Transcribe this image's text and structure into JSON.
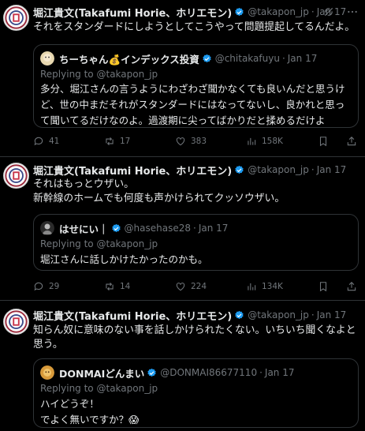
{
  "tweets": [
    {
      "author_name": "堀江貴文(Takafumi Horie、ホリエモン)",
      "handle": "@takapon_jp",
      "date": "Jan 17",
      "text": "それをスタンダードにしようとしてこうやって問題提起してるんだよ。",
      "quote": {
        "author_name": "ちーちゃん💰インデックス投資",
        "handle": "@chitakafuyu",
        "date": "Jan 17",
        "replying_label": "Replying to",
        "replying_to": "@takapon_jp",
        "text": "多分、堀江さんの言うようにわざわざ聞かなくても良いんだと思うけど、世の中まだそれがスタンダードにはなってないし、良かれと思って聞いてるだけなのよ。過渡期に尖ってばかりだと揉めるだけよ"
      },
      "stats": {
        "replies": "41",
        "reposts": "17",
        "likes": "383",
        "views": "158K"
      }
    },
    {
      "author_name": "堀江貴文(Takafumi Horie、ホリエモン)",
      "handle": "@takapon_jp",
      "date": "Jan 17",
      "text": "それはもっとウザい。\n新幹線のホームでも何度も声かけられてクッソウザい。",
      "quote": {
        "author_name": "はせにい｜",
        "handle": "@hasehase28",
        "date": "Jan 17",
        "replying_label": "Replying to",
        "replying_to": "@takapon_jp",
        "text": "堀江さんに話しかけたかったのかも。"
      },
      "stats": {
        "replies": "29",
        "reposts": "14",
        "likes": "224",
        "views": "134K"
      }
    },
    {
      "author_name": "堀江貴文(Takafumi Horie、ホリエモン)",
      "handle": "@takapon_jp",
      "date": "Jan 17",
      "text": "知らん奴に意味のない事を話しかけられたくない。いちいち聞くなよと思う。",
      "quote": {
        "author_name": "DONMAIどんまい",
        "handle": "@DONMAI86677110",
        "date": "Jan 17",
        "replying_label": "Replying to",
        "replying_to": "@takapon_jp",
        "text": "ハイどうぞ！\nでよく無いですか？😱"
      }
    }
  ],
  "icons": {
    "verified": "verified-badge-icon",
    "grok": "grok-icon",
    "more": "more-dots-icon",
    "reply": "reply-icon",
    "repost": "repost-icon",
    "like": "like-icon",
    "views": "views-icon",
    "bookmark": "bookmark-icon",
    "share": "share-icon"
  },
  "colors": {
    "background": "#000000",
    "text": "#e7e9ea",
    "muted": "#71767b",
    "border": "#2f3336",
    "verified": "#1d9bf0"
  }
}
